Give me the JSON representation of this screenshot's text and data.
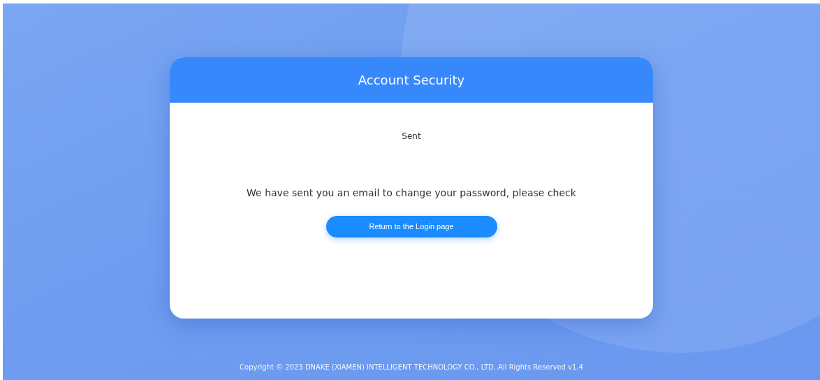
{
  "card": {
    "title": "Account Security",
    "status": "Sent",
    "message": "We have sent you an email to change your password, please check",
    "button": "Return to the Login page"
  },
  "footer": "Copyright © 2023 DNAKE (XIAMEN) INTELLIGENT TECHNOLOGY CO., LTD..All Rights Reserved v1.4"
}
